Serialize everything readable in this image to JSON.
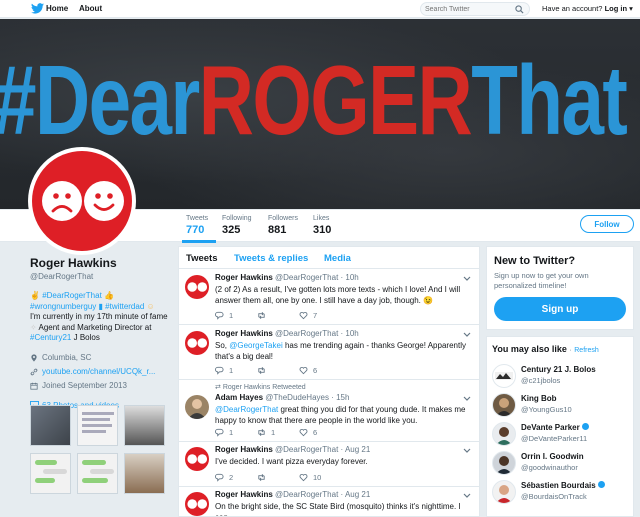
{
  "topbar": {
    "home": "Home",
    "about": "About",
    "search_placeholder": "Search Twitter",
    "have_account": "Have an account?",
    "login": "Log in"
  },
  "banner": {
    "hash": "#Dear",
    "roger": "ROGER",
    "that": "That"
  },
  "profile_nav": {
    "stats": [
      {
        "label": "Tweets",
        "value": "770"
      },
      {
        "label": "Following",
        "value": "325"
      },
      {
        "label": "Followers",
        "value": "881"
      },
      {
        "label": "Likes",
        "value": "310"
      }
    ],
    "follow": "Follow"
  },
  "profile": {
    "name": "Roger Hawkins",
    "handle": "@DearRogerThat",
    "bio": {
      "line1_tag": "#DearRogerThat",
      "line2_tag1": "#wrongnumberguy",
      "line2_tag2": "#twitterdad",
      "line3": "I'm currently in my 17th minute of fame",
      "line4": "Agent and Marketing Director at",
      "line5_tag": "#Century21",
      "line5_rest": "J Bolos"
    },
    "location": "Columbia, SC",
    "url": "youtube.com/channel/UCQk_r...",
    "joined": "Joined September 2013",
    "photos": "63 Photos and videos"
  },
  "timeline": {
    "tabs": [
      "Tweets",
      "Tweets & replies",
      "Media"
    ],
    "tweets": [
      {
        "name": "Roger Hawkins",
        "handle": "@DearRogerThat · 10h",
        "text": "(2 of 2) As a result, I've gotten lots more texts - which I love! And I will answer them all, one by one. I still have a day job, though. 😉",
        "replies": "1",
        "retweets": "",
        "likes": "7"
      },
      {
        "name": "Roger Hawkins",
        "handle": "@DearRogerThat · 10h",
        "text_pre": "So,",
        "text_mention": "@GeorgeTakei",
        "text_post": "has me trending again - thanks George! Apparently that's a big deal!",
        "replies": "1",
        "retweets": "",
        "likes": "6"
      },
      {
        "retweet_note": "Roger Hawkins Retweeted",
        "name": "Adam Hayes",
        "handle": "@TheDudeHayes · 15h",
        "text_mention": "@DearRogerThat",
        "text_post": "great thing you did for that young dude. It makes me happy to know that there are people in the world like you.",
        "replies": "1",
        "retweets": "1",
        "likes": "6"
      },
      {
        "name": "Roger Hawkins",
        "handle": "@DearRogerThat · Aug 21",
        "text": "I've decided. I want pizza everyday forever.",
        "replies": "2",
        "retweets": "",
        "likes": "10"
      },
      {
        "name": "Roger Hawkins",
        "handle": "@DearRogerThat · Aug 21",
        "text": "On the bright side, the SC State Bird (mosquito) thinks it's nighttime. I can"
      }
    ]
  },
  "new_to_twitter": {
    "title": "New to Twitter?",
    "text": "Sign up now to get your own personalized timeline!",
    "button": "Sign up"
  },
  "you_may_also_like": {
    "title": "You may also like",
    "sep": "·",
    "refresh": "Refresh",
    "items": [
      {
        "name": "Century 21 J. Bolos",
        "handle": "@c21jbolos",
        "verified": false
      },
      {
        "name": "King Bob",
        "handle": "@YoungGus10",
        "verified": false
      },
      {
        "name": "DeVante Parker",
        "handle": "@DeVanteParker11",
        "verified": true
      },
      {
        "name": "Orrin I. Goodwin",
        "handle": "@goodwinauthor",
        "verified": false
      },
      {
        "name": "Sébastien Bourdais",
        "handle": "@BourdaisOnTrack",
        "verified": true
      }
    ]
  },
  "colors": {
    "accent": "#1da1f2",
    "avatar_red": "#de1f26",
    "banner_blue": "#2b95d6",
    "banner_red": "#d32a24"
  }
}
